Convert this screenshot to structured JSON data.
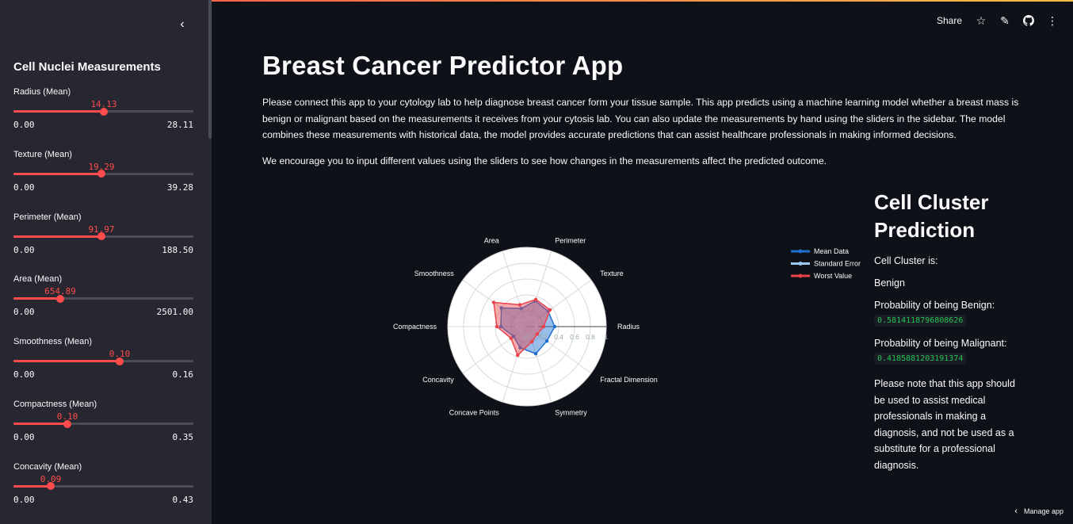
{
  "header": {
    "share_label": "Share"
  },
  "sidebar": {
    "title": "Cell Nuclei Measurements",
    "sliders": [
      {
        "label": "Radius (Mean)",
        "value": "14.13",
        "min": "0.00",
        "max": "28.11",
        "fraction": 0.503
      },
      {
        "label": "Texture (Mean)",
        "value": "19.29",
        "min": "0.00",
        "max": "39.28",
        "fraction": 0.491
      },
      {
        "label": "Perimeter (Mean)",
        "value": "91.97",
        "min": "0.00",
        "max": "188.50",
        "fraction": 0.488
      },
      {
        "label": "Area (Mean)",
        "value": "654.89",
        "min": "0.00",
        "max": "2501.00",
        "fraction": 0.262
      },
      {
        "label": "Smoothness (Mean)",
        "value": "0.10",
        "min": "0.00",
        "max": "0.16",
        "fraction": 0.59
      },
      {
        "label": "Compactness (Mean)",
        "value": "0.10",
        "min": "0.00",
        "max": "0.35",
        "fraction": 0.298
      },
      {
        "label": "Concavity (Mean)",
        "value": "0.09",
        "min": "0.00",
        "max": "0.43",
        "fraction": 0.207
      }
    ]
  },
  "main": {
    "title": "Breast Cancer Predictor App",
    "paragraph1": "Please connect this app to your cytology lab to help diagnose breast cancer form your tissue sample. This app predicts using a machine learning model whether a breast mass is benign or malignant based on the measurements it receives from your cytosis lab. You can also update the measurements by hand using the sliders in the sidebar. The model combines these measurements with historical data, the model provides accurate predictions that can assist healthcare professionals in making informed decisions.",
    "paragraph2": "We encourage you to input different values using the sliders to see how changes in the measurements affect the predicted outcome."
  },
  "prediction": {
    "title": "Cell Cluster Prediction",
    "cluster_label": "Cell Cluster is:",
    "cluster_value": "Benign",
    "benign_label": "Probability of being Benign:",
    "benign_value": "0.5814118796808626",
    "malignant_label": "Probability of being Malignant:",
    "malignant_value": "0.4185881203191374",
    "note": "Please note that this app should be used to assist medical professionals in making a diagnosis, and not be used as a substitute for a professional diagnosis."
  },
  "chart_data": {
    "type": "radar",
    "categories": [
      "Radius",
      "Texture",
      "Perimeter",
      "Area",
      "Smoothness",
      "Compactness",
      "Concavity",
      "Concave Points",
      "Symmetry",
      "Fractal Dimension"
    ],
    "radial_ticks": [
      "0",
      "0.2",
      "0.4",
      "0.6",
      "0.8",
      "1"
    ],
    "range": [
      0,
      1
    ],
    "legend": [
      "Mean Data",
      "Standard Error",
      "Worst Value"
    ],
    "series": [
      {
        "name": "Mean Data",
        "color": "#1f6fd1",
        "values": [
          0.35,
          0.33,
          0.34,
          0.24,
          0.4,
          0.33,
          0.21,
          0.28,
          0.36,
          0.31
        ]
      },
      {
        "name": "Standard Error",
        "color": "#9cc8f0",
        "values": [
          0.12,
          0.14,
          0.12,
          0.08,
          0.15,
          0.13,
          0.09,
          0.15,
          0.13,
          0.1
        ]
      },
      {
        "name": "Worst Value",
        "color": "#e8424a",
        "values": [
          0.21,
          0.36,
          0.36,
          0.29,
          0.52,
          0.38,
          0.25,
          0.38,
          0.2,
          0.16
        ]
      }
    ]
  },
  "footer": {
    "manage_label": "Manage app"
  }
}
